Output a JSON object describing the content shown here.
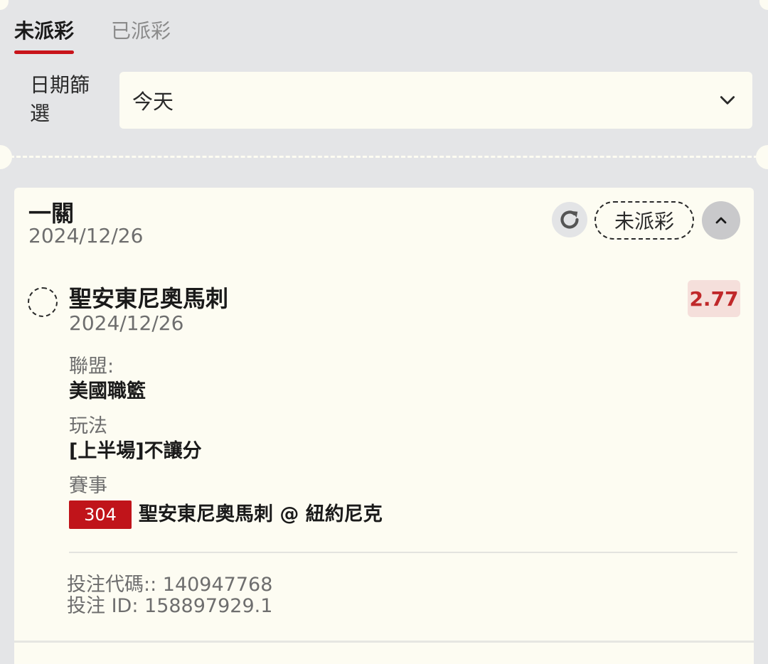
{
  "tabs": [
    {
      "label": "未派彩",
      "active": true
    },
    {
      "label": "已派彩",
      "active": false
    }
  ],
  "filter": {
    "label": "日期篩選",
    "value": "今天",
    "icon": "chevron-down-icon"
  },
  "card": {
    "title": "一關",
    "date": "2024/12/26",
    "status": "未派彩",
    "refresh_icon": "refresh-icon",
    "collapse_icon": "chevron-up-icon",
    "selection": {
      "name": "聖安東尼奧馬刺",
      "date": "2024/12/26",
      "odds": "2.77"
    },
    "league_label": "聯盟:",
    "league_value": "美國職籃",
    "play_label": "玩法",
    "play_value": "[上半場]不讓分",
    "match_label": "賽事",
    "match_code": "304",
    "match_name": "聖安東尼奧馬刺 @ 紐約尼克",
    "bet_code_line": "投注代碼:: 140947768",
    "bet_id_line": "投注 ID: 158897929.1"
  },
  "colors": {
    "background": "#e4e5e7",
    "card": "#fdfcf2",
    "accent": "#c8141b",
    "odds_bg": "#f5dfdb",
    "odds_text": "#c0282a"
  }
}
